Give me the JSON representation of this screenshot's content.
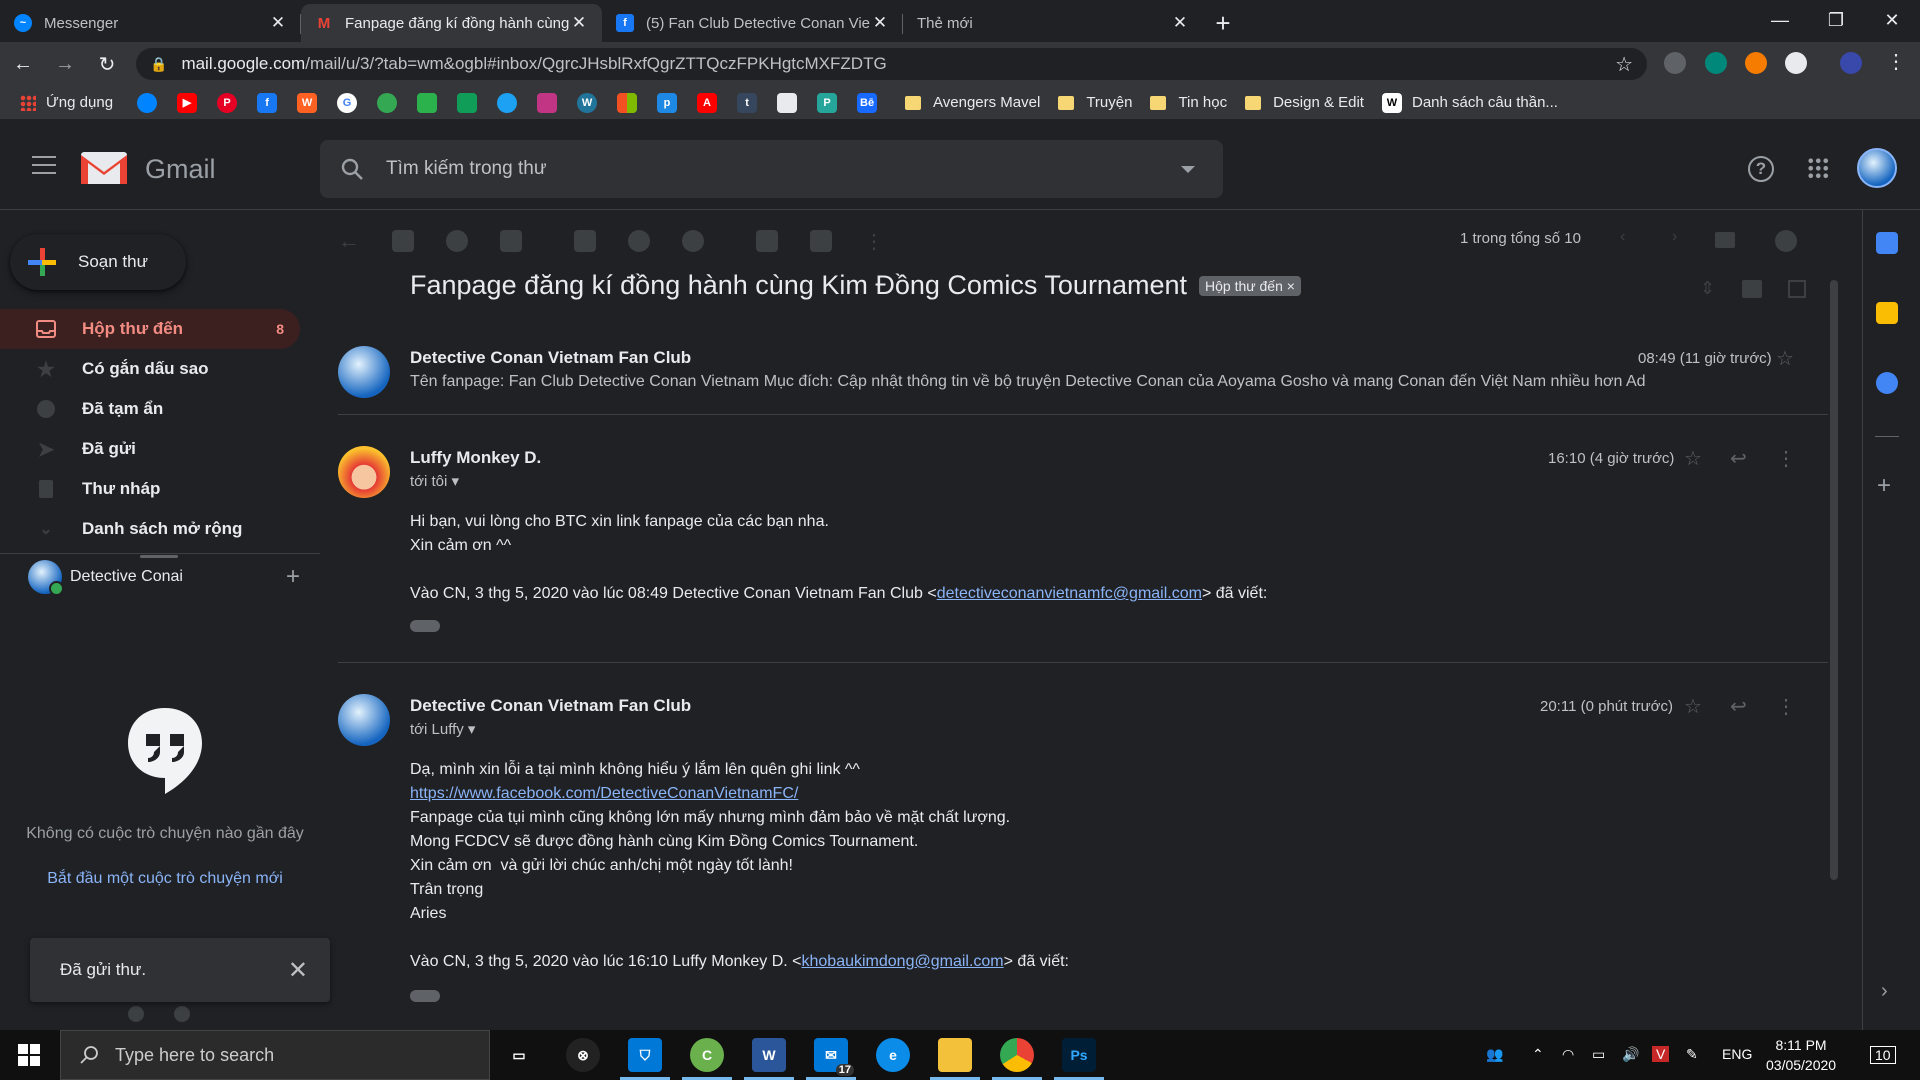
{
  "browser": {
    "tabs": [
      {
        "title": "Messenger",
        "icon": "messenger-icon",
        "color": "#0084ff",
        "active": false
      },
      {
        "title": "Fanpage đăng kí đồng hành cùng",
        "icon": "gmail-icon",
        "color": "#ea4335",
        "active": true
      },
      {
        "title": "(5) Fan Club Detective Conan Vie",
        "icon": "facebook-icon",
        "color": "#1877f2",
        "active": false
      },
      {
        "title": "Thẻ mới",
        "icon": "",
        "color": "",
        "active": false
      }
    ],
    "url_host": "mail.google.com",
    "url_path": "/mail/u/3/?tab=wm&ogbl#inbox/QgrcJHsblRxfQgrZTTQczFPKHgtcMXFZDTG",
    "bookmarks": {
      "apps_label": "Ứng dụng",
      "folders": [
        "Avengers Mavel",
        "Truyện",
        "Tin học",
        "Design & Edit"
      ],
      "last": "Danh sách câu thần..."
    }
  },
  "gmail": {
    "product_name": "Gmail",
    "search_placeholder": "Tìm kiếm trong thư",
    "compose_label": "Soạn thư",
    "nav": [
      {
        "label": "Hộp thư đến",
        "count": "8",
        "icon": "inbox-icon"
      },
      {
        "label": "Có gắn dấu sao",
        "count": "",
        "icon": "star-icon"
      },
      {
        "label": "Đã tạm ẩn",
        "count": "",
        "icon": "clock-icon"
      },
      {
        "label": "Đã gửi",
        "count": "",
        "icon": "send-icon"
      },
      {
        "label": "Thư nháp",
        "count": "",
        "icon": "draft-icon"
      },
      {
        "label": "Danh sách mở rộng",
        "count": "",
        "icon": "chevron-down-icon"
      }
    ],
    "hangouts_user": "Detective Conai",
    "no_chats": "Không có cuộc trò chuyện nào gần đây",
    "start_chat": "Bắt đầu một cuộc trò chuyện mới",
    "toast": "Đã gửi thư.",
    "pager": "1 trong tổng số 10",
    "subject": "Fanpage đăng kí đồng hành cùng Kim Đồng Comics Tournament",
    "label_chip": "Hộp thư đến ×",
    "messages": [
      {
        "sender": "Detective Conan Vietnam Fan Club",
        "time": "08:49 (11 giờ trước)",
        "snippet": "Tên fanpage: Fan Club Detective Conan Vietnam Mục đích: Cập nhật thông tin về bộ truyện Detective Conan của Aoyama Gosho và mang Conan đến Việt Nam nhiều hơn Ad"
      },
      {
        "sender": "Luffy Monkey D.",
        "time": "16:10 (4 giờ trước)",
        "to": "tới tôi",
        "lines": [
          "Hi bạn, vui lòng cho BTC xin link fanpage của các bạn nha.",
          "Xin cảm ơn ^^"
        ],
        "quote_prefix": "Vào CN, 3 thg 5, 2020 vào lúc 08:49 Detective Conan Vietnam Fan Club <",
        "quote_email": "detectiveconanvietnamfc@gmail.com",
        "quote_suffix": "> đã viết:"
      },
      {
        "sender": "Detective Conan Vietnam Fan Club",
        "time": "20:11 (0 phút trước)",
        "to": "tới Luffy",
        "line1": "Dạ, mình xin lỗi a tại mình không hiểu ý lắm lên quên ghi link ^^",
        "link": "https://www.facebook.com/DetectiveConanVietnamFC/",
        "lines": [
          "Fanpage của tụi mình cũng không lớn mấy nhưng mình đảm bảo về mặt chất lượng.",
          "Mong FCDCV sẽ được đồng hành cùng Kim Đồng Comics Tournament.",
          "Xin cảm ơn  và gửi lời chúc anh/chị một ngày tốt lành!",
          "Trân trọng",
          "Aries"
        ],
        "quote_prefix": "Vào CN, 3 thg 5, 2020 vào lúc 16:10 Luffy Monkey D. <",
        "quote_email": "khobaukimdong@gmail.com",
        "quote_suffix": "> đã viết:"
      }
    ]
  },
  "taskbar": {
    "search_placeholder": "Type here to search",
    "mail_badge": "17",
    "lang": "ENG",
    "time": "8:11 PM",
    "date": "03/05/2020",
    "notif_count": "10"
  }
}
